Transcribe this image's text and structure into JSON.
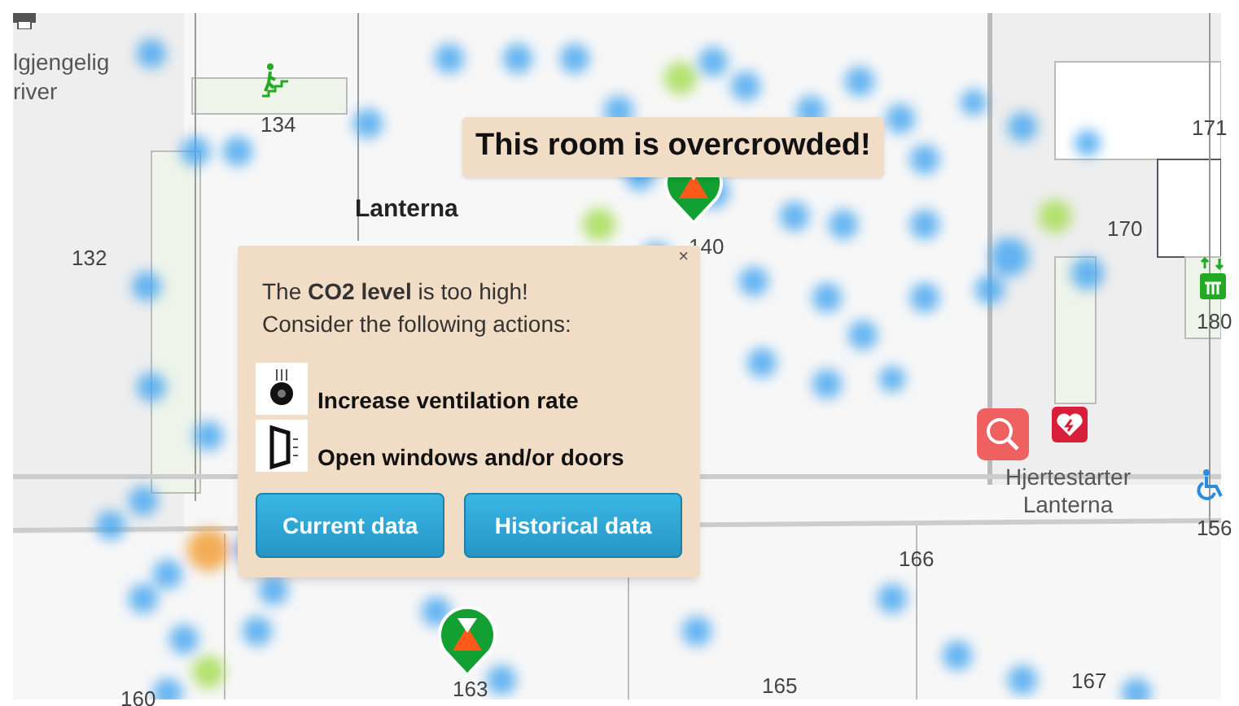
{
  "map": {
    "room_labels": [
      "134",
      "132",
      "140",
      "171",
      "170",
      "180",
      "156",
      "166",
      "165",
      "167",
      "163",
      "160"
    ],
    "place_labels": [
      {
        "text": "lgjengelig",
        "kind": "plain"
      },
      {
        "text": "river",
        "kind": "plain"
      },
      {
        "text": "Lanterna",
        "kind": "bold"
      },
      {
        "text": "Hjertestarter Lanterna",
        "kind": "plain"
      }
    ]
  },
  "tooltip": {
    "text": "This room is overcrowded!"
  },
  "popup": {
    "close": "×",
    "message": [
      "The **CO2 level** is too high!",
      "Consider the following actions:"
    ],
    "actions": [
      {
        "label": "Increase ventilation rate",
        "kind": "fan"
      },
      {
        "label": "Open windows and/or doors",
        "kind": "window"
      }
    ],
    "buttons": [
      "Current data",
      "Historical data"
    ]
  }
}
